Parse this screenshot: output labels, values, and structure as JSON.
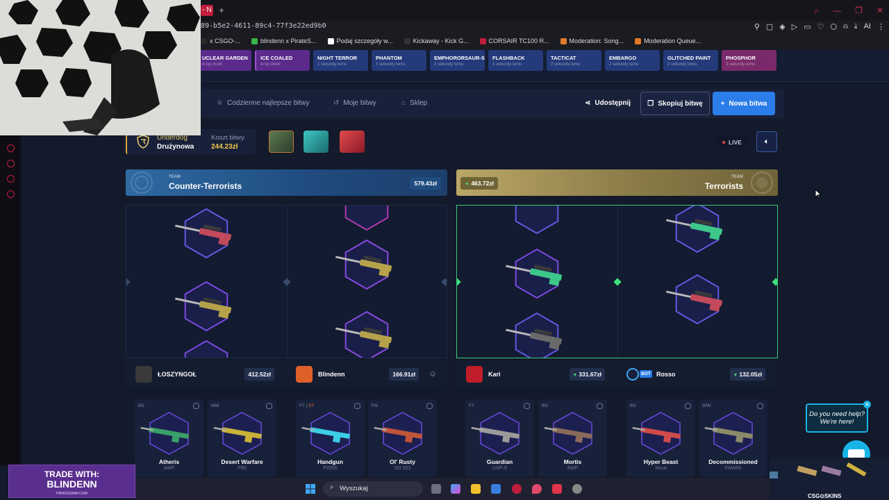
{
  "browser": {
    "tab_stub": "- N",
    "new_tab": "+",
    "url": "89-b5e2-4611-89c4-77f3e22ed9b0",
    "bookmarks": [
      {
        "label": "x CSGO-...",
        "color": "#2b2b2b"
      },
      {
        "label": "blindenn x PirateS...",
        "color": "#39b54a"
      },
      {
        "label": "Podaj szczegóły w...",
        "color": "#ffffff"
      },
      {
        "label": "Kickaway - Kick G...",
        "color": "#333333"
      },
      {
        "label": "CORSAIR TC100 R...",
        "color": "#c01e3c"
      },
      {
        "label": "Moderation: Song...",
        "color": "#e07a2a"
      },
      {
        "label": "Moderation Queue...",
        "color": "#e07a2a"
      }
    ],
    "extension_ai": "AI"
  },
  "case_strip": [
    {
      "name": "UCLEAR GARDEN",
      "sub": "w tej chwili",
      "style": "t-purple"
    },
    {
      "name": "ICE COALED",
      "sub": "w tej chwili",
      "style": "t-purple"
    },
    {
      "name": "NIGHT TERROR",
      "sub": "1 sekundy temu",
      "style": "t-blue"
    },
    {
      "name": "PHANTOM",
      "sub": "1 sekundy temu",
      "style": "t-blue"
    },
    {
      "name": "EMPHORORSAUR-S",
      "sub": "2 sekundy temu",
      "style": "t-blue"
    },
    {
      "name": "FLASHBACK",
      "sub": "2 sekundy temu",
      "style": "t-blue"
    },
    {
      "name": "TACTICAT",
      "sub": "2 sekundy temu",
      "style": "t-blue"
    },
    {
      "name": "EMBARGO",
      "sub": "2 sekundy temu",
      "style": "t-blue"
    },
    {
      "name": "GLITCHED PAINT",
      "sub": "2 sekundy temu",
      "style": "t-blue"
    },
    {
      "name": "PHOSPHOR",
      "sub": "3 sekundy temu",
      "style": "t-pink"
    }
  ],
  "subnav": {
    "daily_best": "Codzienne najlepsze bitwy",
    "my_battles": "Moje bitwy",
    "shop": "Sklep",
    "share": "Udostępnij",
    "copy": "Skopiuj bitwę",
    "new_battle": "Nowa bitwa"
  },
  "battle": {
    "mode_l1": "Underdog",
    "mode_l2": "Drużynowa",
    "cost_label": "Koszt bitwy",
    "cost_value": "244.23zł",
    "live": "LIVE"
  },
  "teams": {
    "ct": {
      "small": "TEAM",
      "name": "Counter-Terrorists",
      "value": "579.43zł",
      "color": "#2f6aa3"
    },
    "t": {
      "small": "TEAM",
      "name": "Terrorists",
      "value": "463.72zł",
      "color": "#bba767"
    }
  },
  "players": [
    {
      "name": "ŁOSZYNGOŁ",
      "value": "412.52zł",
      "down": false,
      "bot": false
    },
    {
      "name": "Blindenn",
      "value": "166.91zł",
      "down": false,
      "bot": false
    },
    {
      "name": "Kari",
      "value": "331.67zł",
      "down": true,
      "bot": false
    },
    {
      "name": "Rosso",
      "value": "132.05zł",
      "down": true,
      "bot": true,
      "bot_label": "BOT"
    }
  ],
  "items": [
    {
      "cond": "BS",
      "st": "",
      "name": "Atheris",
      "type": "AWP",
      "color": "#3aa06a"
    },
    {
      "cond": "MW",
      "st": "",
      "name": "Desert Warfare",
      "type": "P90",
      "color": "#c9b238"
    },
    {
      "cond": "FT | ",
      "st": "ST",
      "name": "Handgun",
      "type": "P2000",
      "color": "#3ccde6"
    },
    {
      "cond": "FN",
      "st": "",
      "name": "Ol' Rusty",
      "type": "SG 553",
      "color": "#c0553a"
    },
    {
      "cond": "FT",
      "st": "",
      "name": "Guardian",
      "type": "USP-S",
      "color": "#9a9a9a"
    },
    {
      "cond": "BS",
      "st": "",
      "name": "Mortis",
      "type": "AWP",
      "color": "#8a6a5a"
    },
    {
      "cond": "BS",
      "st": "",
      "name": "Hyper Beast",
      "type": "Nova",
      "color": "#d04a4a"
    },
    {
      "cond": "WW",
      "st": "",
      "name": "Decommissioned",
      "type": "FAMAS",
      "color": "#8a8a6a"
    }
  ],
  "overlays": {
    "trade_l1": "TRADE WITH:",
    "trade_l2": "BLINDENN",
    "trade_l3": "PIRATESWAP.COM",
    "help_text": "Do you need help? We're here!",
    "csgoskins": "CSG⊙SKINS"
  },
  "taskbar": {
    "search": "Wyszukaj"
  }
}
